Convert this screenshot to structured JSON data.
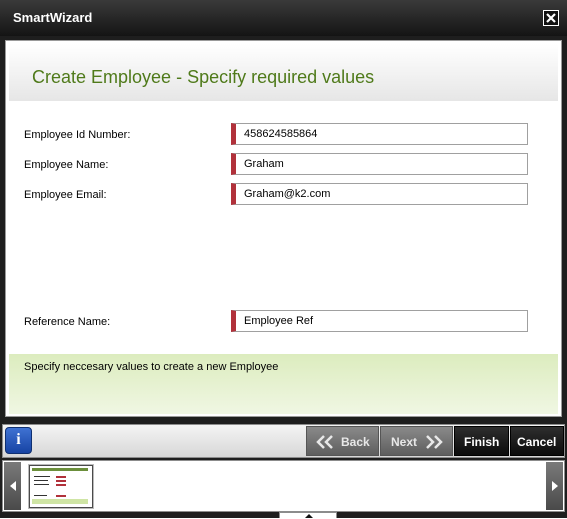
{
  "window": {
    "title": "SmartWizard"
  },
  "header": {
    "title": "Create Employee - Specify required values"
  },
  "fields": [
    {
      "label": "Employee Id Number:",
      "value": "458624585864"
    },
    {
      "label": "Employee Name:",
      "value": "Graham"
    },
    {
      "label": "Employee Email:",
      "value": "Graham@k2.com"
    },
    {
      "label": "Reference Name:",
      "value": "Employee Ref"
    }
  ],
  "hint": {
    "text": "Specify neccesary values to create a new Employee"
  },
  "toolbar": {
    "info_label": "i",
    "back_label": "Back",
    "next_label": "Next",
    "finish_label": "Finish",
    "cancel_label": "Cancel"
  },
  "colors": {
    "title_green": "#4f7a1a",
    "required_marker": "#b1313b",
    "hint_band": "#dcecbe",
    "titlebar": "#1e1e1e"
  },
  "icons": {
    "close": "close-icon",
    "info": "info-icon",
    "back": "double-chevron-left-icon",
    "next": "double-chevron-right-icon",
    "strip_left": "triangle-left-icon",
    "strip_right": "triangle-right-icon",
    "collapse": "triangle-up-icon"
  }
}
